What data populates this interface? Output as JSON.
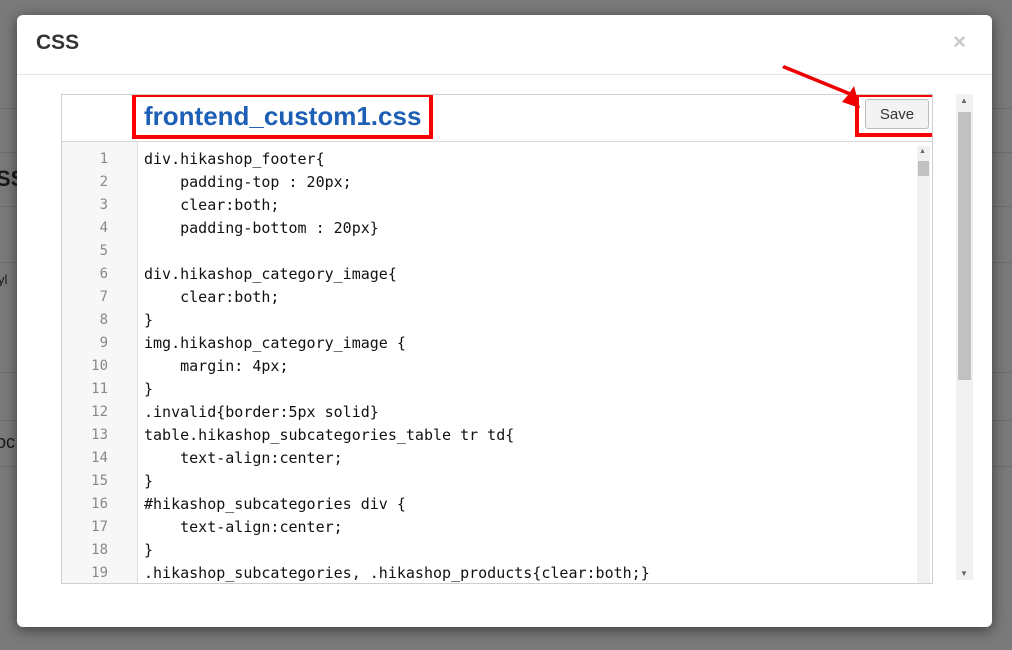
{
  "background_page": {
    "fragment_1": "SS",
    "fragment_2": "oc",
    "fragment_3": "yl"
  },
  "modal": {
    "title": "CSS",
    "close_glyph": "×"
  },
  "editor": {
    "file_name": "frontend_custom1.css",
    "save_label": "Save",
    "line_numbers": [
      "1",
      "2",
      "3",
      "4",
      "5",
      "6",
      "7",
      "8",
      "9",
      "10",
      "11",
      "12",
      "13",
      "14",
      "15",
      "16",
      "17",
      "18",
      "19"
    ],
    "lines": [
      "div.hikashop_footer{",
      "    padding-top : 20px;",
      "    clear:both;",
      "    padding-bottom : 20px}",
      "",
      "div.hikashop_category_image{",
      "    clear:both;",
      "}",
      "img.hikashop_category_image {",
      "    margin: 4px;",
      "}",
      ".invalid{border:5px solid}",
      "table.hikashop_subcategories_table tr td{",
      "    text-align:center;",
      "}",
      "#hikashop_subcategories div {",
      "    text-align:center;",
      "}",
      ".hikashop_subcategories, .hikashop_products{clear:both;}"
    ]
  },
  "colors": {
    "highlight": "#ff0000",
    "file_name": "#1e5fb6"
  },
  "icons": {
    "annotation": "red-arrow-icon",
    "close": "close-icon"
  }
}
